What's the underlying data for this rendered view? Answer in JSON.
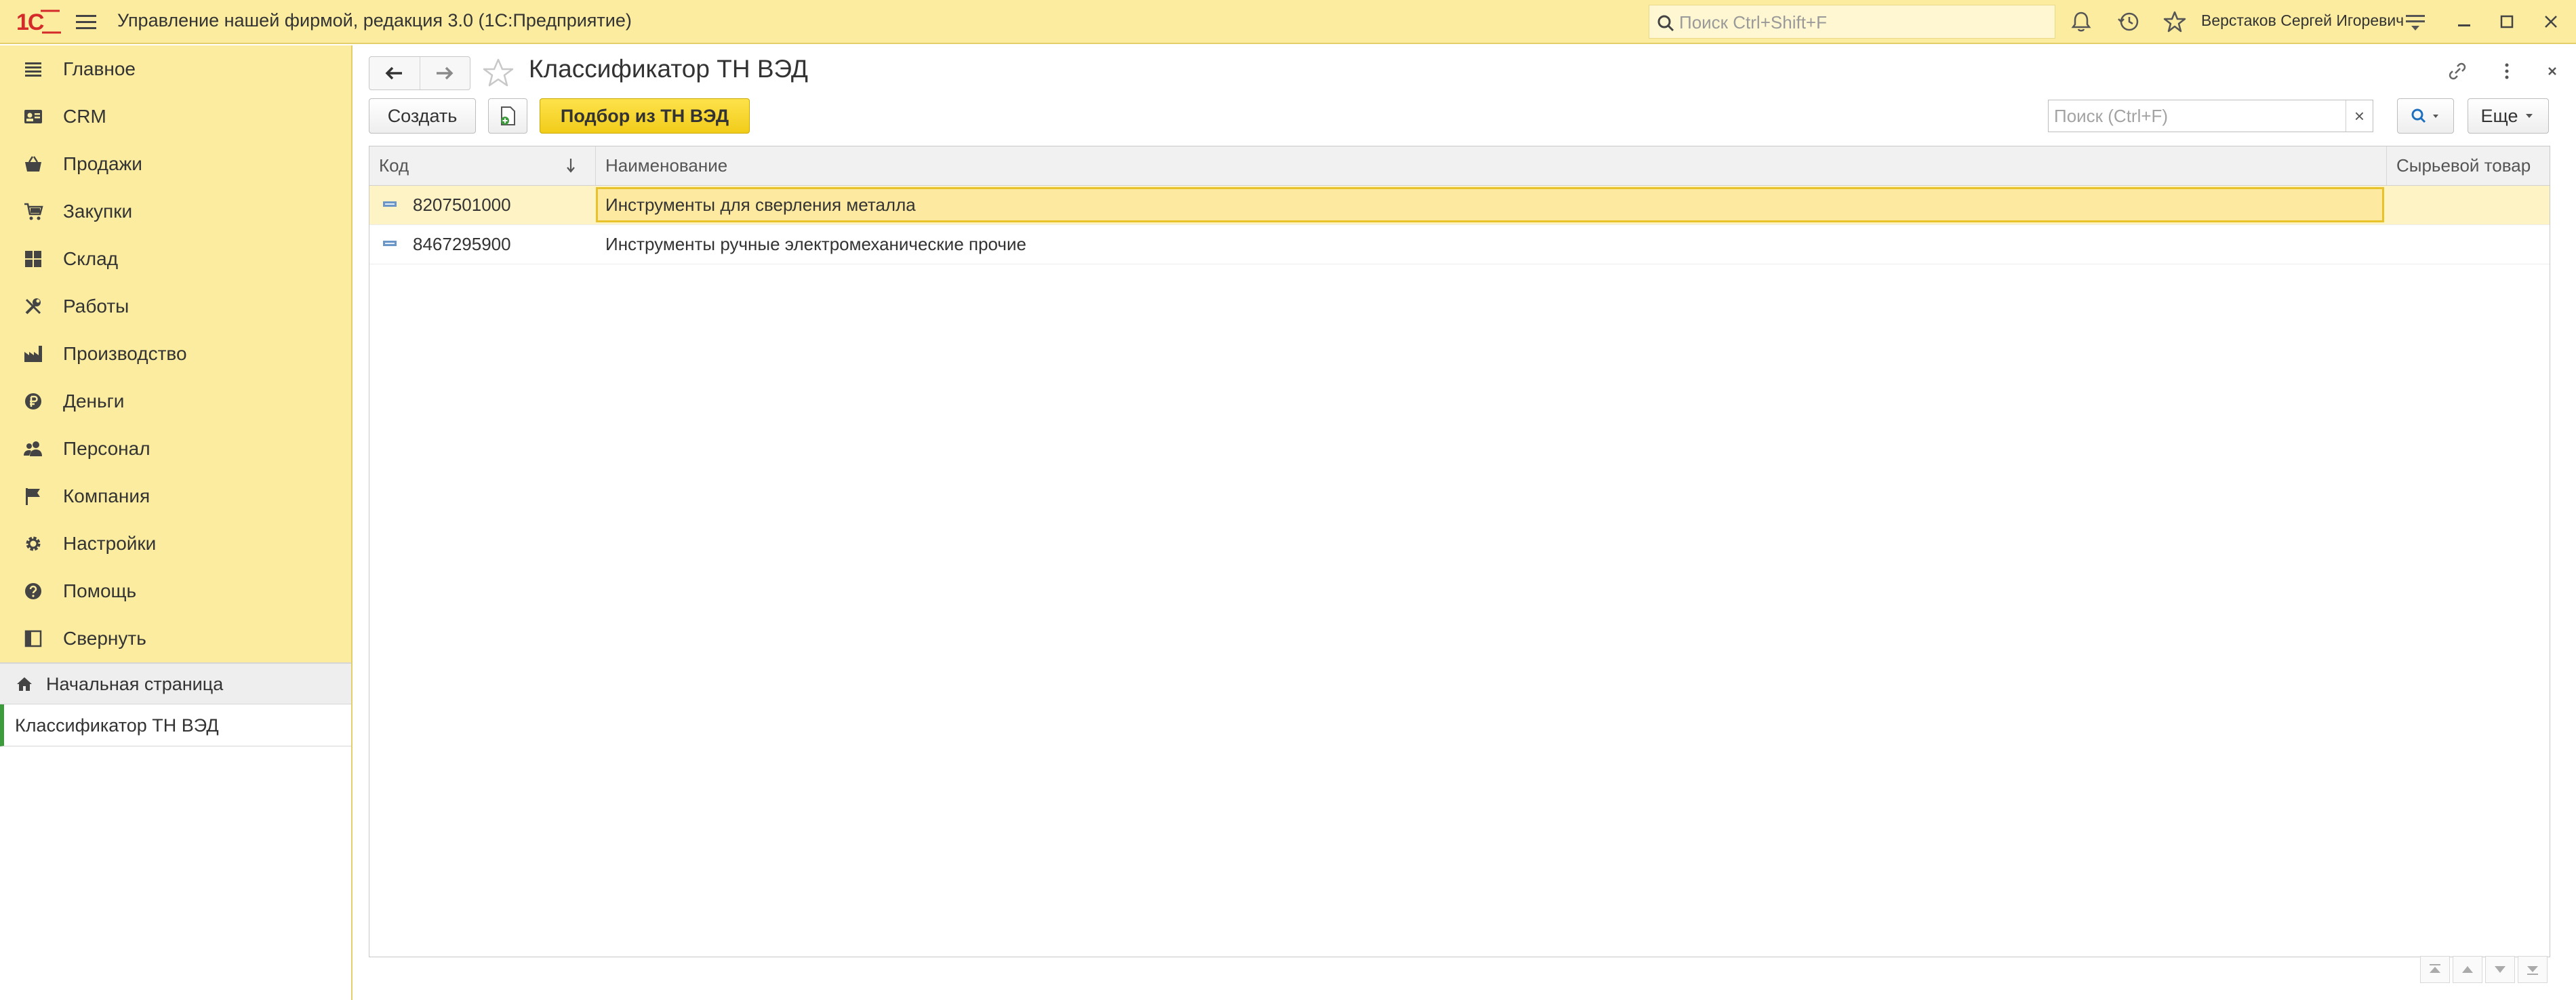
{
  "titlebar": {
    "logo_text": "1С",
    "app_title": "Управление нашей фирмой, редакция 3.0  (1С:Предприятие)",
    "search_placeholder": "Поиск Ctrl+Shift+F",
    "user_name": "Верстаков Сергей Игоревич",
    "icons": [
      "bell-icon",
      "history-icon",
      "star-icon",
      "settings-lines-icon",
      "minimize-icon",
      "maximize-icon",
      "close-icon"
    ]
  },
  "sidebar": {
    "items": [
      {
        "label": "Главное",
        "icon": "menu-lines-icon"
      },
      {
        "label": "CRM",
        "icon": "contact-card-icon"
      },
      {
        "label": "Продажи",
        "icon": "basket-icon"
      },
      {
        "label": "Закупки",
        "icon": "cart-icon"
      },
      {
        "label": "Склад",
        "icon": "warehouse-icon"
      },
      {
        "label": "Работы",
        "icon": "tools-icon"
      },
      {
        "label": "Производство",
        "icon": "factory-icon"
      },
      {
        "label": "Деньги",
        "icon": "ruble-icon"
      },
      {
        "label": "Персонал",
        "icon": "people-icon"
      },
      {
        "label": "Компания",
        "icon": "flag-icon"
      },
      {
        "label": "Настройки",
        "icon": "gear-icon"
      },
      {
        "label": "Помощь",
        "icon": "help-icon"
      },
      {
        "label": "Свернуть",
        "icon": "collapse-panel-icon"
      }
    ],
    "open_windows": {
      "home_label": "Начальная страница",
      "current_label": "Классификатор ТН ВЭД"
    }
  },
  "form": {
    "title": "Классификатор ТН ВЭД",
    "create_label": "Создать",
    "pick_label": "Подбор из ТН ВЭД",
    "search_placeholder": "Поиск (Ctrl+F)",
    "clear_label": "×",
    "more_label": "Еще",
    "columns": [
      "Код",
      "Наименование",
      "Сырьевой товар"
    ],
    "rows": [
      {
        "code": "8207501000",
        "name": "Инструменты для сверления металла",
        "raw": ""
      },
      {
        "code": "8467295900",
        "name": "Инструменты ручные электромеханические прочие",
        "raw": ""
      }
    ]
  },
  "colors": {
    "panel_yellow": "#fbeca0",
    "primary_button": "#f7d52c",
    "selected_row": "#fdf3c5",
    "accent_green": "#3d9a3d",
    "logo_red": "#d42a2a"
  }
}
